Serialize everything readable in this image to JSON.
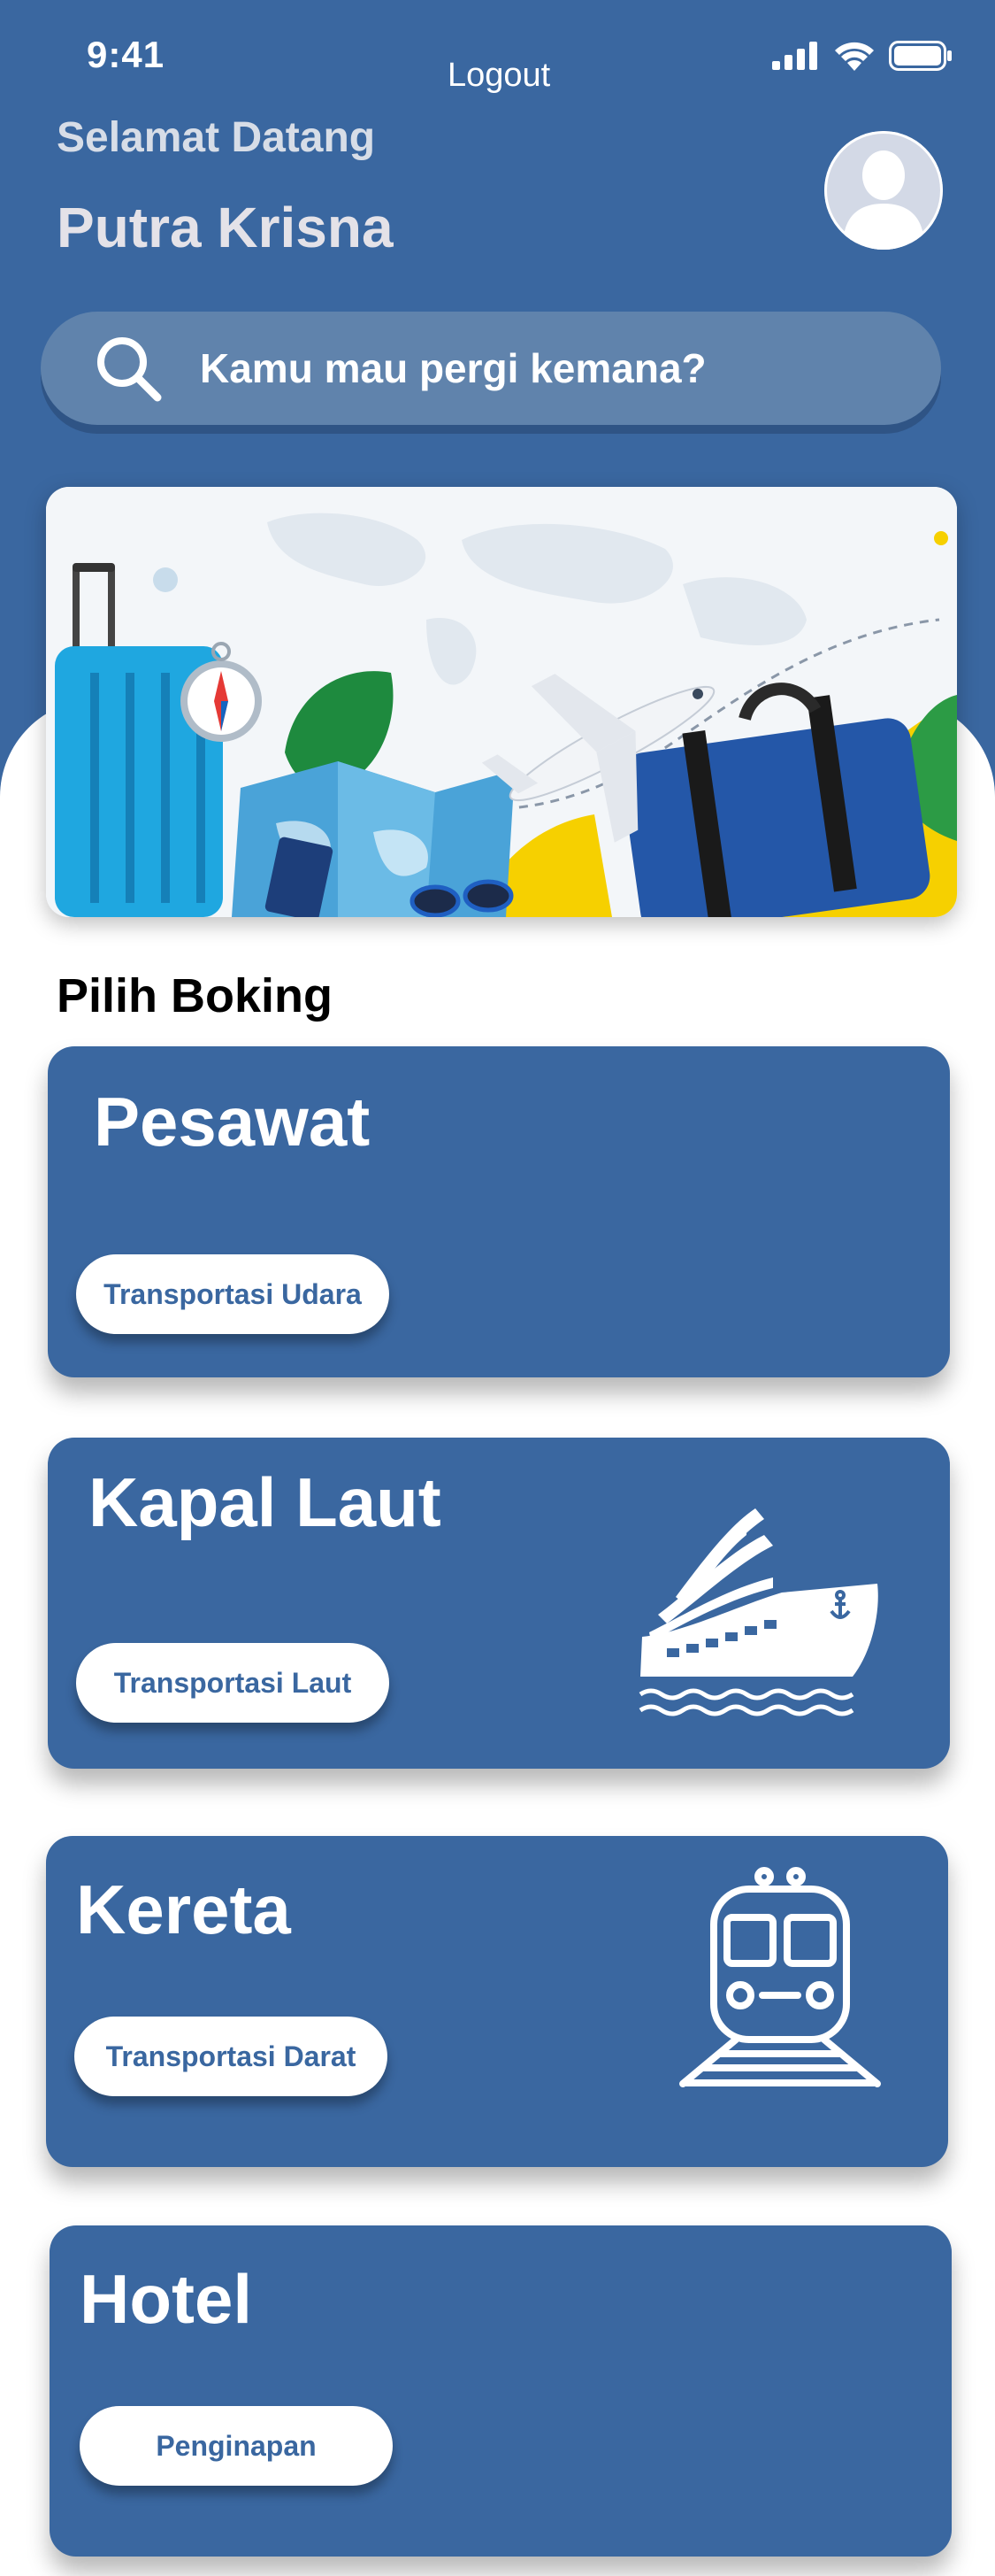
{
  "status_bar": {
    "time": "9:41"
  },
  "header": {
    "logout_label": "Logout",
    "greeting": "Selamat Datang",
    "user_name": "Putra Krisna"
  },
  "search": {
    "placeholder": "Kamu mau pergi kemana?"
  },
  "section": {
    "title": "Pilih Boking"
  },
  "cards": [
    {
      "title": "Pesawat",
      "button": "Transportasi Udara",
      "icon": "airplane-icon"
    },
    {
      "title": "Kapal Laut",
      "button": "Transportasi Laut",
      "icon": "ship-icon"
    },
    {
      "title": "Kereta",
      "button": "Transportasi Darat",
      "icon": "train-icon"
    },
    {
      "title": "Hotel",
      "button": "Penginapan",
      "icon": "hotel-icon"
    }
  ],
  "colors": {
    "primary": "#3a67a0",
    "search_bg": "#6083ac",
    "background": "#ffffff"
  }
}
